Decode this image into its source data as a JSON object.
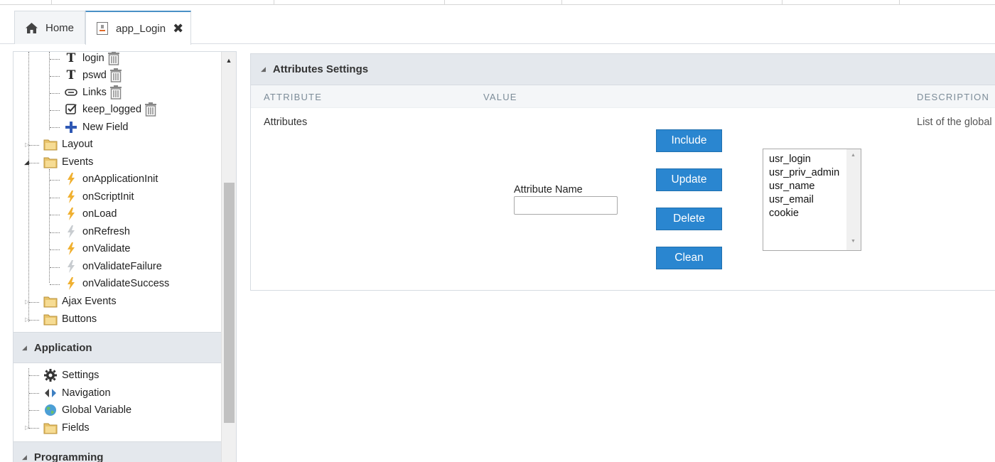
{
  "tabs": {
    "home_label": "Home",
    "app_label": "app_Login",
    "close_glyph": "✖"
  },
  "tree": {
    "fields": [
      {
        "label": "login",
        "icon": "text-field-icon"
      },
      {
        "label": "pswd",
        "icon": "text-field-icon"
      },
      {
        "label": "Links",
        "icon": "link-field-icon"
      },
      {
        "label": "keep_logged",
        "icon": "checkbox-field-icon"
      },
      {
        "label": "New Field",
        "icon": "plus-icon"
      }
    ],
    "layout": "Layout",
    "events": "Events",
    "event_items": [
      {
        "label": "onApplicationInit",
        "active": true
      },
      {
        "label": "onScriptInit",
        "active": true
      },
      {
        "label": "onLoad",
        "active": true
      },
      {
        "label": "onRefresh",
        "active": false
      },
      {
        "label": "onValidate",
        "active": true
      },
      {
        "label": "onValidateFailure",
        "active": false
      },
      {
        "label": "onValidateSuccess",
        "active": true
      }
    ],
    "ajax_events": "Ajax Events",
    "buttons": "Buttons"
  },
  "application": {
    "title": "Application",
    "items": [
      {
        "label": "Settings",
        "icon": "gear-icon"
      },
      {
        "label": "Navigation",
        "icon": "navigation-icon"
      },
      {
        "label": "Global Variable",
        "icon": "globe-icon"
      },
      {
        "label": "Fields",
        "icon": "folder-icon"
      }
    ]
  },
  "programming": {
    "title": "Programming"
  },
  "panel": {
    "title": "Attributes Settings",
    "col_attribute": "ATTRIBUTE",
    "col_value": "VALUE",
    "col_description": "DESCRIPTION",
    "row_label": "Attributes",
    "row_description": "List of the global",
    "attr_name_label": "Attribute Name",
    "attr_name_value": "",
    "buttons": {
      "include": "Include",
      "update": "Update",
      "delete": "Delete",
      "clean": "Clean"
    },
    "attributes": [
      "usr_login",
      "usr_priv_admin",
      "usr_name",
      "usr_email",
      "cookie"
    ]
  },
  "colors": {
    "accent": "#2a86d0",
    "header_bg": "#e4e8ed",
    "bolt_active": "#f0b030",
    "bolt_inactive": "#c8ccd0"
  }
}
